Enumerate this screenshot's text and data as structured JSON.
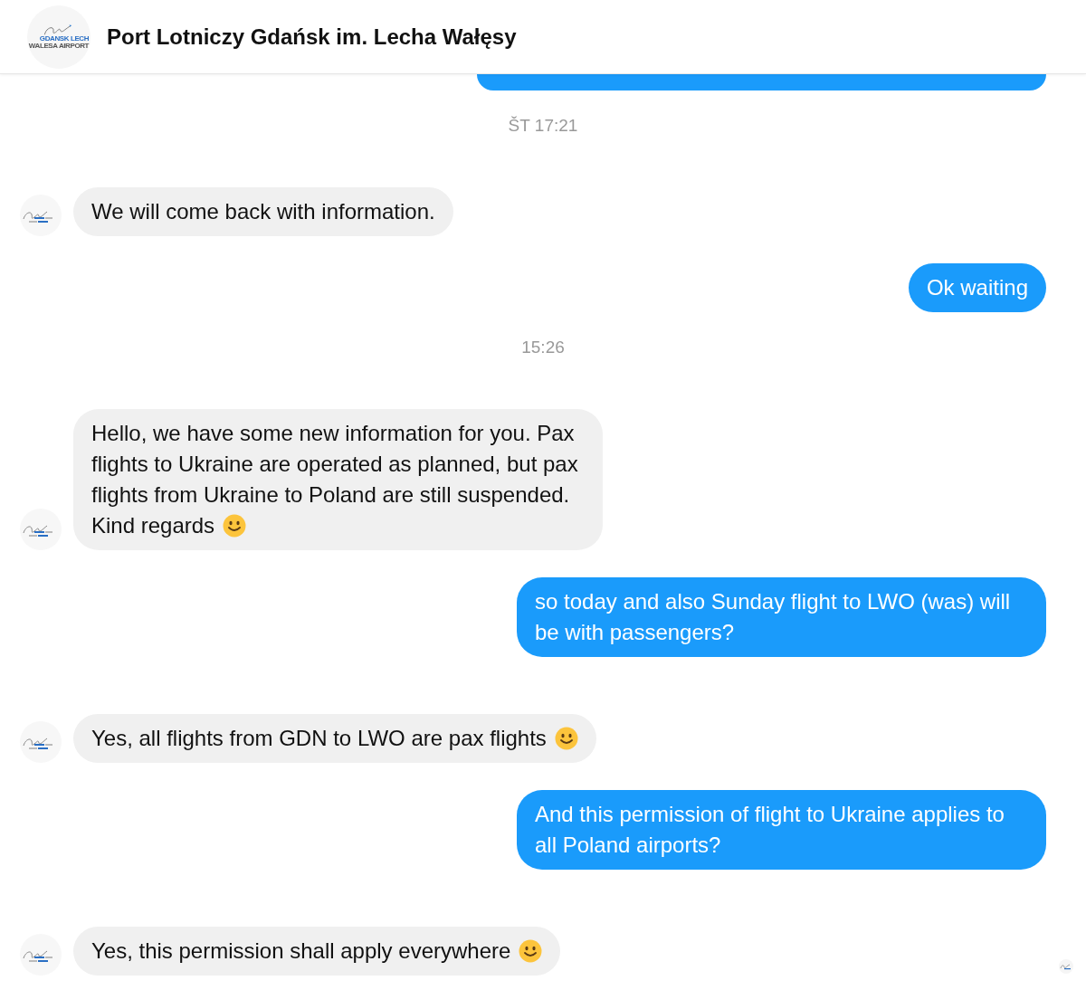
{
  "header": {
    "title": "Port Lotniczy Gdańsk im. Lecha Wałęsy",
    "logo_text": [
      "GDANSK LECH",
      "WALESA AIRPORT"
    ]
  },
  "messages": [
    {
      "kind": "outgoing-cut"
    },
    {
      "kind": "timestamp",
      "text": "ŠT 17:21"
    },
    {
      "kind": "incoming",
      "text": "We will come back with information.",
      "emoji": false
    },
    {
      "kind": "outgoing",
      "text": "Ok waiting",
      "emoji": false
    },
    {
      "kind": "timestamp",
      "text": "15:26"
    },
    {
      "kind": "incoming",
      "text": "Hello, we have some new information for you. Pax flights to Ukraine are operated as planned, but pax flights from Ukraine to Poland are still suspended. Kind regards",
      "emoji": true
    },
    {
      "kind": "outgoing",
      "text": "so today and also Sunday flight to LWO (was) will be with passengers?",
      "emoji": false
    },
    {
      "kind": "incoming",
      "text": "Yes, all flights from GDN to LWO are pax flights",
      "emoji": true
    },
    {
      "kind": "outgoing",
      "text": "And this permission of flight to Ukraine applies to all Poland airports?",
      "emoji": false
    },
    {
      "kind": "incoming",
      "text": "Yes, this permission shall apply everywhere",
      "emoji": true
    }
  ],
  "read_receipt": true
}
